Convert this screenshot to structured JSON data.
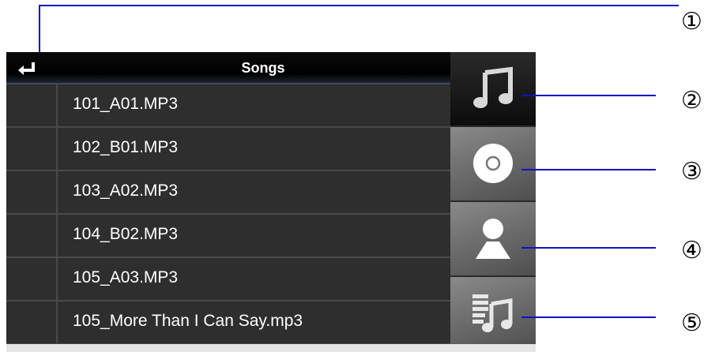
{
  "header": {
    "title": "Songs"
  },
  "songs": [
    "101_A01.MP3",
    "102_B01.MP3",
    "103_A02.MP3",
    "104_B02.MP3",
    "105_A03.MP3",
    "105_More Than I Can Say.mp3"
  ],
  "tabs": [
    {
      "icon": "music-note-icon",
      "active": true
    },
    {
      "icon": "disc-icon",
      "active": false
    },
    {
      "icon": "artist-icon",
      "active": false
    },
    {
      "icon": "playlist-icon",
      "active": false
    }
  ],
  "callouts": [
    "①",
    "②",
    "③",
    "④",
    "⑤"
  ],
  "colors": {
    "callout_line": "#1010c8",
    "tab_active": "#0c0c0c",
    "row_bg": "#2e2e2e"
  }
}
